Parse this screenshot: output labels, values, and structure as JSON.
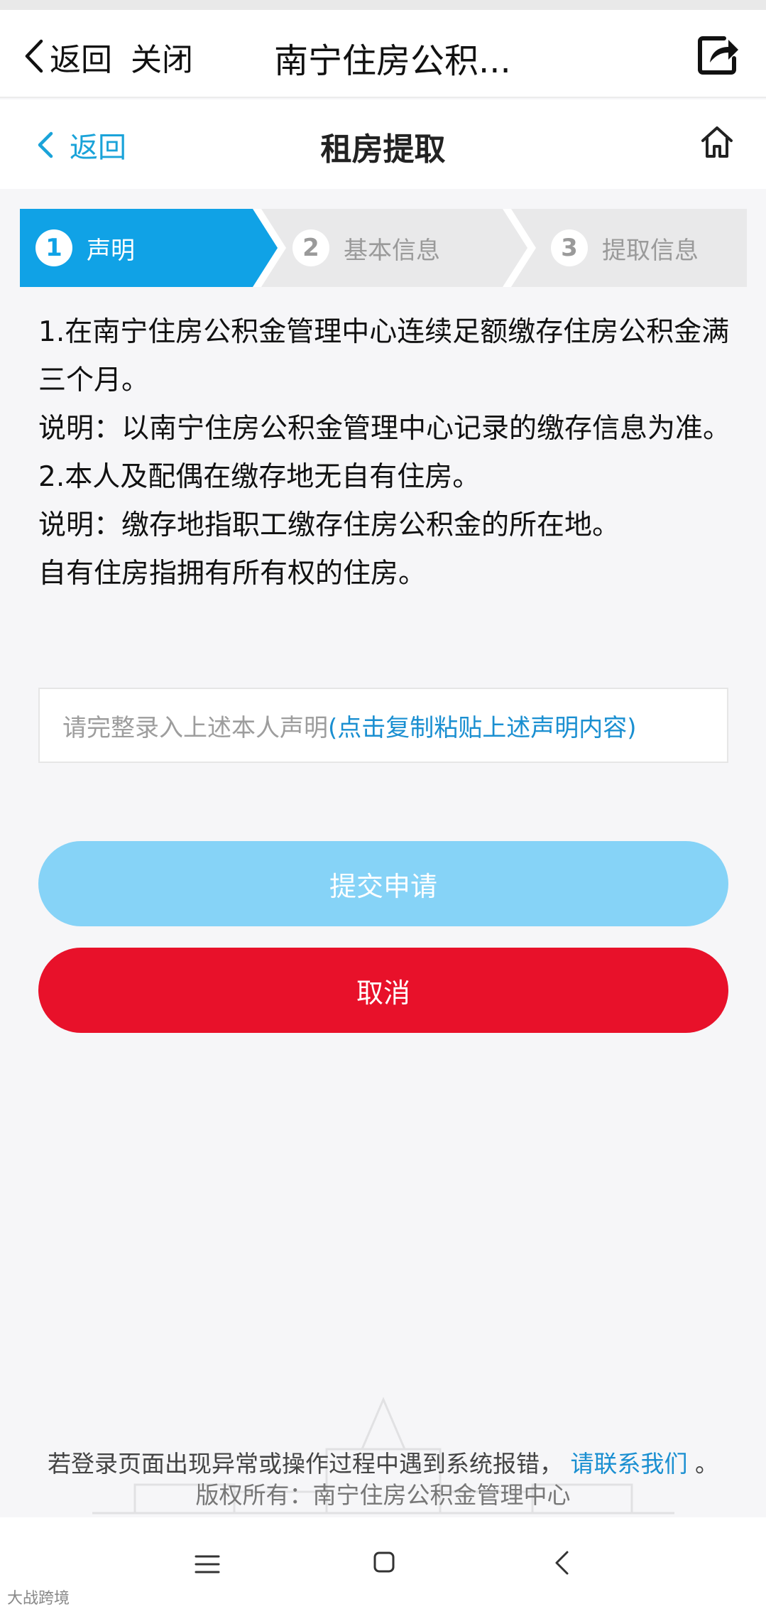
{
  "app_bar": {
    "back_label": "返回",
    "close_label": "关闭",
    "title": "南宁住房公积..."
  },
  "sub_header": {
    "back_label": "返回",
    "title": "租房提取"
  },
  "stepper": {
    "steps": [
      {
        "num": "1",
        "label": "声明",
        "state": "active"
      },
      {
        "num": "2",
        "label": "基本信息",
        "state": "inactive"
      },
      {
        "num": "3",
        "label": "提取信息",
        "state": "inactive"
      }
    ]
  },
  "declaration": {
    "lines": [
      "1.在南宁住房公积金管理中心连续足额缴存住房公积金满三个月。",
      "说明：以南宁住房公积金管理中心记录的缴存信息为准。",
      "2.本人及配偶在缴存地无自有住房。",
      "说明：缴存地指职工缴存住房公积金的所在地。",
      "自有住房指拥有所有权的住房。"
    ]
  },
  "input": {
    "placeholder": "请完整录入上述本人声明",
    "copy_link": "(点击复制粘贴上述声明内容)"
  },
  "buttons": {
    "submit": "提交申请",
    "cancel": "取消"
  },
  "footer": {
    "notice": "若登录页面出现异常或操作过程中遇到系统报错，",
    "contact_link": "请联系我们",
    "notice_end": "。",
    "copyright": "版权所有：南宁住房公积金管理中心"
  },
  "watermark": "大战跨境",
  "colors": {
    "accent": "#10a2e6",
    "link": "#1a8fd1",
    "submit_bg": "#86d3f7",
    "cancel_bg": "#e8112a",
    "step_inactive_bg": "#e9e9ea"
  },
  "icons": {
    "app_back": "chevron-left-icon",
    "share": "share-icon",
    "home": "home-icon",
    "nav_menu": "menu-icon",
    "nav_home": "square-icon",
    "nav_back": "back-icon"
  }
}
